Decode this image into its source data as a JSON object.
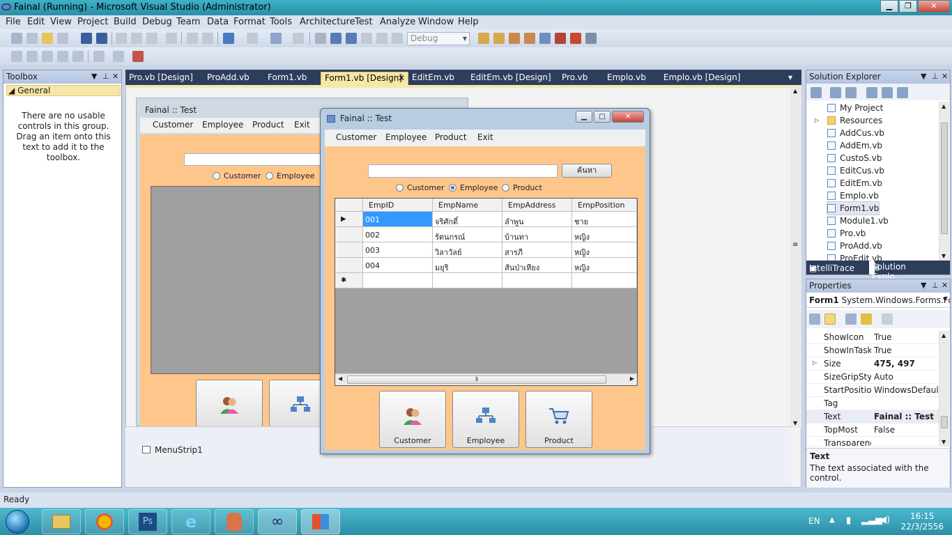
{
  "window": {
    "title": "Fainal (Running) - Microsoft Visual Studio (Administrator)"
  },
  "menu": [
    "File",
    "Edit",
    "View",
    "Project",
    "Build",
    "Debug",
    "Team",
    "Data",
    "Format",
    "Tools",
    "Architecture",
    "Test",
    "Analyze",
    "Window",
    "Help"
  ],
  "toolbar": {
    "config": "Debug"
  },
  "toolbox": {
    "title": "Toolbox",
    "group": "General",
    "empty_text": "There are no usable controls in this group. Drag an item onto this text to add it to the toolbox."
  },
  "doc_tabs": [
    "Pro.vb [Design]",
    "ProAdd.vb",
    "Form1.vb",
    "Form1.vb [Design]",
    "EditEm.vb",
    "EditEm.vb [Design]",
    "Pro.vb",
    "Emplo.vb",
    "Emplo.vb [Design]"
  ],
  "active_tab": "Form1.vb [Design]",
  "designer_form": {
    "title": "Fainal :: Test",
    "menu": [
      "Customer",
      "Employee",
      "Product",
      "Exit"
    ],
    "radios": [
      "Customer",
      "Employee"
    ],
    "tray_item": "MenuStrip1"
  },
  "running_form": {
    "title": "Fainal :: Test",
    "menu": [
      "Customer",
      "Employee",
      "Product",
      "Exit"
    ],
    "search_button": "ค้นหา",
    "radios": [
      {
        "label": "Customer",
        "checked": false
      },
      {
        "label": "Employee",
        "checked": true
      },
      {
        "label": "Product",
        "checked": false
      }
    ],
    "grid": {
      "columns": [
        "EmpID",
        "EmpName",
        "EmpAddress",
        "EmpPosition"
      ],
      "rows": [
        [
          "001",
          "จริศักดิ์",
          "ลำพูน",
          "ชาย"
        ],
        [
          "002",
          "รัตนกรณ์",
          "บ้านทา",
          "หญิง"
        ],
        [
          "003",
          "วิลาวัลย์",
          "สารภี",
          "หญิง"
        ],
        [
          "004",
          "มยุริ",
          "สันป่าเหียง",
          "หญิง"
        ]
      ]
    },
    "buttons": [
      "Customer",
      "Employee",
      "Product"
    ]
  },
  "solution_explorer": {
    "title": "Solution Explorer",
    "items": [
      "My Project",
      "Resources",
      "AddCus.vb",
      "AddEm.vb",
      "CustoS.vb",
      "EditCus.vb",
      "EditEm.vb",
      "Emplo.vb",
      "Form1.vb",
      "Module1.vb",
      "Pro.vb",
      "ProAdd.vb",
      "ProEdit.vb"
    ],
    "selected": "Form1.vb",
    "tabs": [
      "IntelliTrace",
      "Solution Explo..."
    ]
  },
  "properties": {
    "title": "Properties",
    "object_name": "Form1",
    "object_type": "System.Windows.Forms.Fo",
    "rows": [
      {
        "name": "ShowIcon",
        "value": "True"
      },
      {
        "name": "ShowInTaskb",
        "value": "True"
      },
      {
        "name": "Size",
        "value": "475, 497"
      },
      {
        "name": "SizeGripStyle",
        "value": "Auto"
      },
      {
        "name": "StartPosition",
        "value": "WindowsDefaultl"
      },
      {
        "name": "Tag",
        "value": ""
      },
      {
        "name": "Text",
        "value": "Fainal :: Test"
      },
      {
        "name": "TopMost",
        "value": "False"
      },
      {
        "name": "Transparency",
        "value": ""
      }
    ],
    "desc_title": "Text",
    "desc_text": "The text associated with the control."
  },
  "status": "Ready",
  "taskbar": {
    "lang": "EN",
    "time": "16:15",
    "date": "22/3/2556"
  }
}
